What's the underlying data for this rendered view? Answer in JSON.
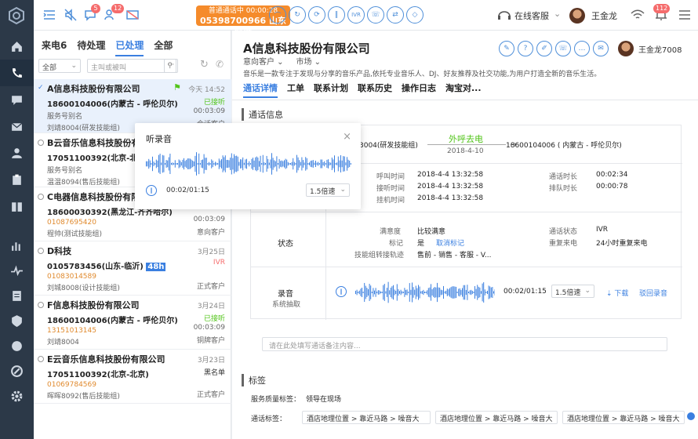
{
  "topbar": {
    "badges": [
      "5",
      "12",
      "112"
    ],
    "call_status": "普通通话中",
    "call_time": "00:00:28",
    "call_number": "05398700966 山东临沂",
    "call_buttons": [
      "IVR"
    ],
    "agent_status": "在线客服",
    "user_name": "王金龙"
  },
  "left": {
    "tabs": [
      "来电6",
      "待处理",
      "已处理",
      "全部"
    ],
    "filter_value": "全部",
    "search_placeholder": "主叫或被叫",
    "more": "···",
    "items": [
      {
        "name": "A信息科技股份有限公司",
        "date": "今天 14:52",
        "phone": "18600104006(内蒙古 - 呼伦贝尔)",
        "status": "已接听",
        "sub1": "服务号别名",
        "time": "00:03:09",
        "sub2": "刘靖8004(研发技能组)",
        "tag": "会话客户"
      },
      {
        "name": "B云音乐信息科技股份有",
        "date": "",
        "phone": "17051100392(北京-北京)",
        "status": "",
        "sub1": "服务号别名",
        "time": "",
        "sub2": "温温8094(售后技能组)",
        "tag": ""
      },
      {
        "name": "C电器信息科技股份有限公",
        "date": "",
        "phone": "18600030392(黑龙江-齐齐哈尔)",
        "status": "",
        "sub1": "01087695420",
        "time": "00:03:09",
        "sub2": "程帅(测试技能组)",
        "tag": "意向客户"
      },
      {
        "name": "D科技",
        "date": "3月25日",
        "phone": "0105783456(山东-临沂)",
        "phone_tag": "48h",
        "status": "IVR",
        "sub1": "01083014589",
        "time": "",
        "sub2": "刘城8008(设计技能组)",
        "tag": "正式客户"
      },
      {
        "name": "F信息科技股份有限公司",
        "date": "3月24日",
        "phone": "18600104006(内蒙古 - 呼伦贝尔)",
        "status": "已接听",
        "sub1": "13151013145",
        "time": "00:03:09",
        "sub2": "刘靖8004",
        "tag": "铜牌客户"
      },
      {
        "name": "E云音乐信息科技股份有限公司",
        "date": "3月23日",
        "phone": "17051100392(北京-北京)",
        "status": "黑名单",
        "sub1": "01069784569",
        "time": "",
        "sub2": "晖晖8092(售后技能组)",
        "tag": "正式客户"
      }
    ]
  },
  "popup": {
    "title": "听录音",
    "time": "00:02/01:15",
    "speed": "1.5倍速"
  },
  "main": {
    "company": "A信息科技股份有限公司",
    "level": "意向客户",
    "source": "市场",
    "desc": "音乐是一款专注于发现与分享的音乐产品,依托专业音乐人、DJ、好友推荐及社交功能,为用户打造全新的音乐生活。",
    "tabs": [
      "通话详情",
      "工单",
      "联系计划",
      "联系历史",
      "操作日志",
      "淘宝对..."
    ],
    "user": "王金龙7008",
    "section_call": "通话信息",
    "from_agent": "3004(研发技能组)",
    "direction": "外呼去电",
    "call_date": "2018-4-10",
    "to_number": "18600104006 ( 内蒙古 - 呼伦贝尔)",
    "labels": {
      "call_time": "呼叫时间",
      "answer_time": "接听时间",
      "hangup_time": "挂机时间",
      "duration": "通话时长",
      "queue": "排队时长",
      "satisfaction": "满意度",
      "mark": "标记",
      "track": "技能组转接轨迹",
      "call_status": "通话状态",
      "repeat": "重复来电",
      "state": "状态",
      "record": "录音",
      "record_sub": "系统抽取"
    },
    "values": {
      "call_time": "2018-4-4 13:32:58",
      "answer_time": "2018-4-4 13:32:58",
      "hangup_time": "2018-4-4 13:32:58",
      "duration": "00:02:34",
      "queue": "00:00:78",
      "satisfaction": "比较满意",
      "mark": "是",
      "mark_link": "取消标记",
      "track": "售前 - 销售 - 客服 - V...",
      "call_status": "IVR",
      "repeat": "24小时重复来电"
    },
    "player_time": "00:02/01:15",
    "player_speed": "1.5倍速",
    "download": "下载",
    "callback": "驳回录音",
    "notes_placeholder": "请在此处填写通话备注内容...",
    "section_tags": "标签",
    "quality_label": "服务质量标签：",
    "quality_value": "领导在现场",
    "call_tag_label": "通话标签：",
    "tags": [
      "酒店地理位置 > 靠近马路 > 噪音大",
      "酒店地理位置 > 靠近马路 > 噪音大",
      "酒店地理位置 > 靠近马路 > 噪音大"
    ]
  }
}
